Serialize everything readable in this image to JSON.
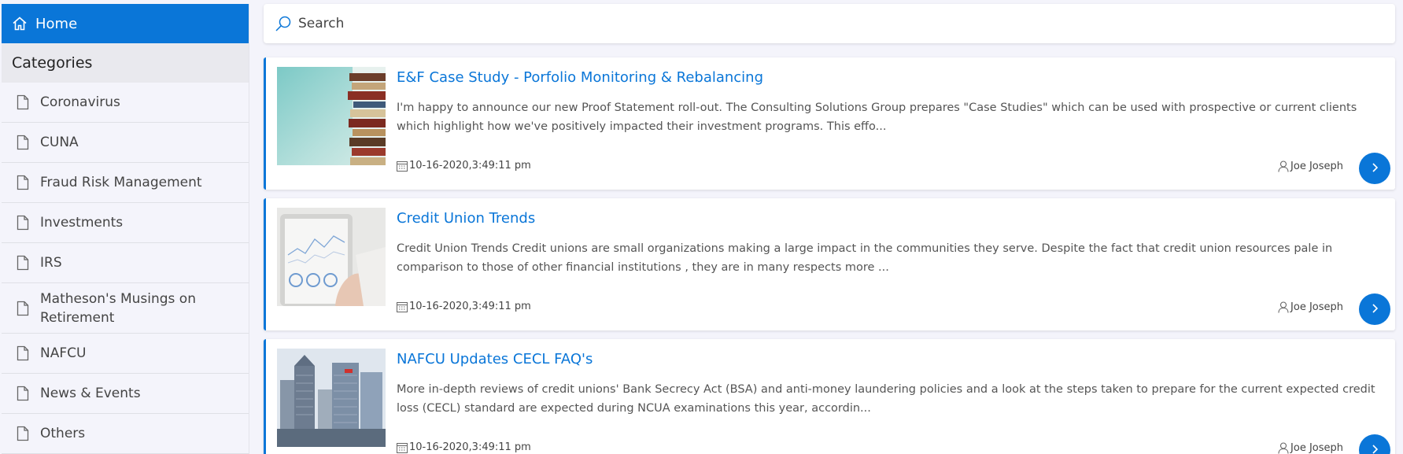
{
  "sidebar": {
    "home_label": "Home",
    "categories_title": "Categories",
    "items": [
      {
        "label": "Coronavirus"
      },
      {
        "label": "CUNA"
      },
      {
        "label": "Fraud Risk Management"
      },
      {
        "label": "Investments"
      },
      {
        "label": "IRS"
      },
      {
        "label": "Matheson's Musings on Retirement"
      },
      {
        "label": "NAFCU"
      },
      {
        "label": "News & Events"
      },
      {
        "label": "Others"
      }
    ]
  },
  "search": {
    "placeholder": "Search",
    "value": ""
  },
  "posts": [
    {
      "title": "E&F Case Study - Porfolio Monitoring & Rebalancing",
      "excerpt": "I'm happy to announce our new Proof Statement roll-out. The Consulting Solutions Group prepares \"Case Studies\" which can be used with prospective or current clients which highlight how we've positively impacted their investment programs. This effo...",
      "date": "10-16-2020,3:49:11 pm",
      "author": "Joe Joseph",
      "thumbnail": "books-icon"
    },
    {
      "title": "Credit Union Trends",
      "excerpt": "Credit Union Trends Credit unions are small organizations making a large impact in the communities they serve. Despite the fact that credit union resources pale in comparison to those of other financial institutions , they are in many respects more ...",
      "date": "10-16-2020,3:49:11 pm",
      "author": "Joe Joseph",
      "thumbnail": "tablet-chart-icon"
    },
    {
      "title": "NAFCU Updates CECL FAQ's",
      "excerpt": "More in-depth reviews of credit unions' Bank Secrecy Act (BSA) and anti-money laundering policies and a look at the steps taken to prepare for the current expected credit loss (CECL) standard are expected during NCUA examinations this year, accordin...",
      "date": "10-16-2020,3:49:11 pm",
      "author": "Joe Joseph",
      "thumbnail": "skyscrapers-icon"
    }
  ],
  "colors": {
    "accent": "#0a76d8",
    "background": "#f4f4fb",
    "card": "#ffffff"
  }
}
